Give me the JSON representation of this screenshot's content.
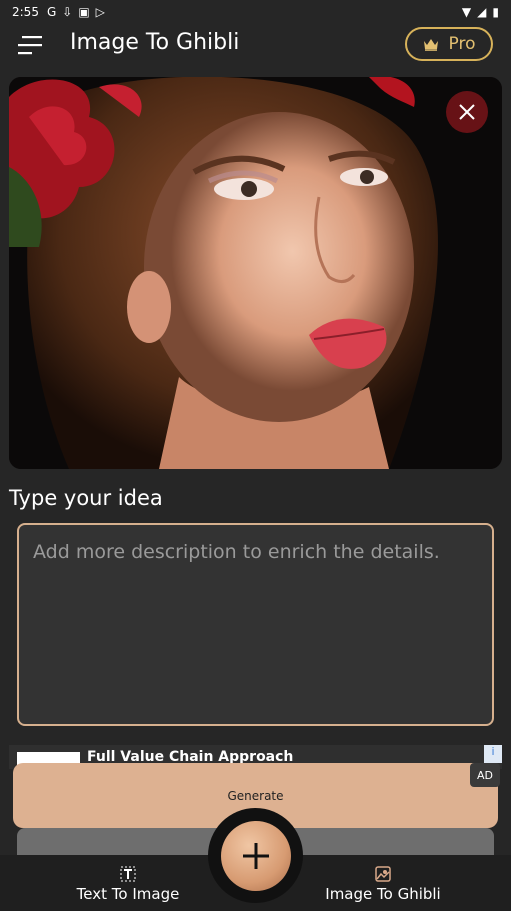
{
  "status_bar": {
    "time": "2:55",
    "icons": [
      "google-g-icon",
      "download-icon",
      "notification-a-icon",
      "play-store-icon"
    ],
    "right_icons": [
      "wifi-icon",
      "signal-icon",
      "battery-icon"
    ]
  },
  "app_bar": {
    "title": "Image To Ghibli",
    "pro_label": "Pro"
  },
  "hero": {
    "close_label": ""
  },
  "prompt": {
    "label": "Type your idea",
    "placeholder": "Add more description to enrich the details."
  },
  "ad": {
    "title": "Full Value Chain Approach",
    "badge": "AD",
    "choice": "i"
  },
  "generate": {
    "label": "Generate"
  },
  "bottom_nav": {
    "left_label": "Text To Image",
    "right_label": "Image To Ghibli"
  },
  "colors": {
    "background": "#262626",
    "accent_gold": "#d7b25a",
    "generate_bg": "#ddb191",
    "textarea_border": "#d6b08e"
  }
}
